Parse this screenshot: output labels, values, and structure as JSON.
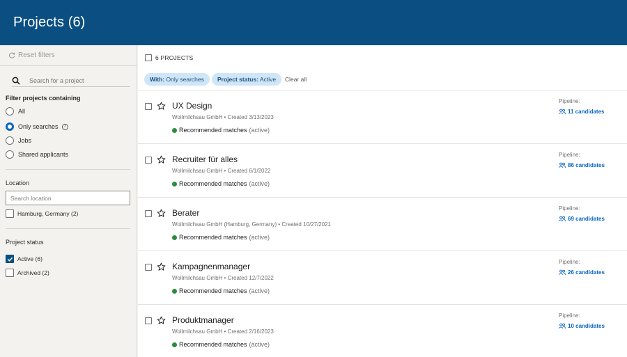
{
  "header": {
    "title": "Projects (6)"
  },
  "sidebar": {
    "reset_label": "Reset filters",
    "search_placeholder": "Search for a project",
    "filter_title": "Filter projects containing",
    "filter_options": [
      {
        "label": "All",
        "selected": false
      },
      {
        "label": "Only searches",
        "selected": true
      },
      {
        "label": "Jobs",
        "selected": false
      },
      {
        "label": "Shared applicants",
        "selected": false
      }
    ],
    "location_title": "Location",
    "location_placeholder": "Search location",
    "location_options": [
      {
        "label": "Hamburg, Germany (2)",
        "checked": false
      }
    ],
    "status_title": "Project status",
    "status_options": [
      {
        "label": "Active (6)",
        "checked": true
      },
      {
        "label": "Archived (2)",
        "checked": false
      }
    ]
  },
  "toolbar": {
    "select_all_label": "6 PROJECTS",
    "pills": [
      {
        "key": "With:",
        "value": "Only searches"
      },
      {
        "key": "Project status:",
        "value": "Active"
      }
    ],
    "clear_all": "Clear all"
  },
  "projects": [
    {
      "title": "UX Design",
      "subtitle": "Wollmilchsau GmbH • Created 3/13/2023",
      "match": "Recommended matches",
      "match_state": "(active)",
      "pipeline_label": "Pipeline:",
      "candidates": "11 candidates"
    },
    {
      "title": "Recruiter für alles",
      "subtitle": "Wollmilchsau GmbH • Created 6/1/2022",
      "match": "Recommended matches",
      "match_state": "(active)",
      "pipeline_label": "Pipeline:",
      "candidates": "86 candidates"
    },
    {
      "title": "Berater",
      "subtitle": "Wollmilchsau GmbH (Hamburg, Germany) • Created 10/27/2021",
      "match": "Recommended matches",
      "match_state": "(active)",
      "pipeline_label": "Pipeline:",
      "candidates": "69 candidates"
    },
    {
      "title": "Kampagnenmanager",
      "subtitle": "Wollmilchsau GmbH • Created 12/7/2022",
      "match": "Recommended matches",
      "match_state": "(active)",
      "pipeline_label": "Pipeline:",
      "candidates": "26 candidates"
    },
    {
      "title": "Produktmanager",
      "subtitle": "Wollmilchsau GmbH • Created 2/16/2023",
      "match": "Recommended matches",
      "match_state": "(active)",
      "pipeline_label": "Pipeline:",
      "candidates": "10 candidates"
    }
  ],
  "colors": {
    "header_bg": "#0b4f82",
    "accent": "#0a66c2",
    "pill_bg": "#cfe6f8",
    "active_dot": "#2e8b3c"
  }
}
